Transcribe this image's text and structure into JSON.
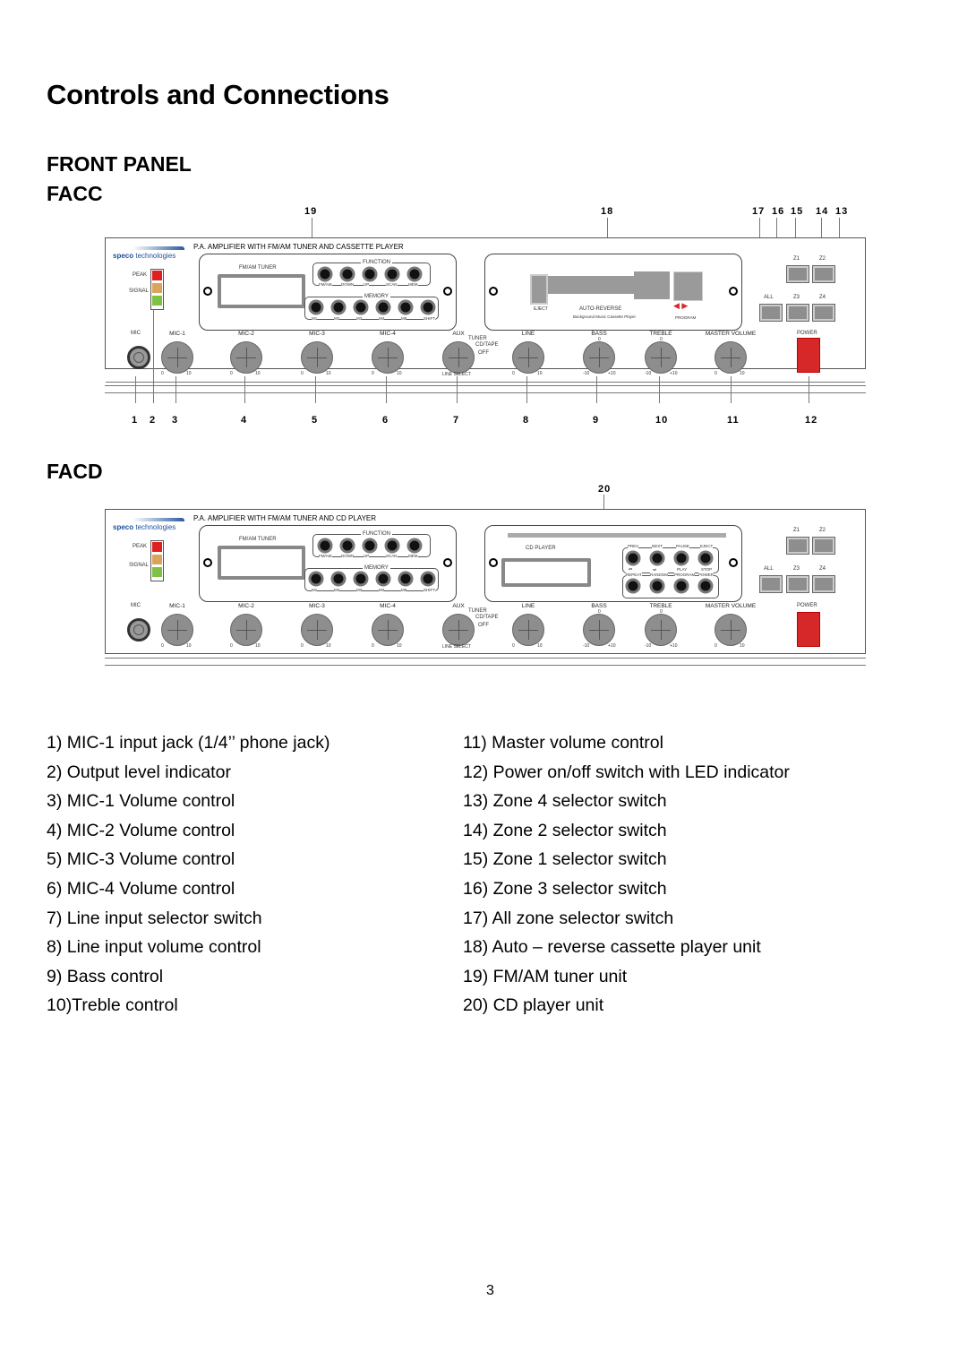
{
  "page": {
    "title": "Controls and Connections",
    "section": "FRONT PANEL",
    "page_number": "3"
  },
  "facc": {
    "heading": "FACC",
    "panel_title": "P.A. AMPLIFIER WITH FM/AM TUNER AND CASSETTE PLAYER",
    "logo": {
      "brand": "speco",
      "suffix": " technologies"
    },
    "indicators": {
      "peak": "PEAK",
      "signal": "SIGNAL",
      "colors": [
        "#e02020",
        "#d9a55a",
        "#7cc243"
      ]
    },
    "tuner": {
      "label": "FM/AM TUNER",
      "function_label": "FUNCTION",
      "function_buttons": [
        "FM/AM",
        "DOWN",
        "UP",
        "SCAN",
        "MEM"
      ],
      "memory_label": "MEMORY",
      "memory_buttons": [
        "M1",
        "M2",
        "M3",
        "M4",
        "M5",
        "SHIFT"
      ]
    },
    "cassette": {
      "eject": "EJECT",
      "auto_reverse": "AUTO-REVERSE",
      "subtitle": "Background Music Cassette Player",
      "program": "PROGRAM"
    },
    "zones": [
      "Z1",
      "Z2",
      "ALL",
      "Z3",
      "Z4"
    ],
    "controls": {
      "mic": "MIC",
      "mic1": "MIC-1",
      "mic2": "MIC-2",
      "mic3": "MIC-3",
      "mic4": "MIC-4",
      "aux": "AUX",
      "tuner": "TUNER",
      "cdtape": "CD/TAPE",
      "off": "OFF",
      "line_select": "LINE SELECT",
      "line": "LINE",
      "bass": "BASS",
      "treble": "TREBLE",
      "master": "MASTER VOLUME",
      "power": "POWER",
      "scale_min": "0",
      "scale_max": "10",
      "tone_min": "-10",
      "tone_max": "+10",
      "tone_mid": "0"
    },
    "callouts_top": [
      "19",
      "18",
      "17",
      "16",
      "15",
      "14",
      "13"
    ],
    "callouts_bottom": [
      "1",
      "2",
      "3",
      "4",
      "5",
      "6",
      "7",
      "8",
      "9",
      "10",
      "11",
      "12"
    ]
  },
  "facd": {
    "heading": "FACD",
    "panel_title": "P.A. AMPLIFIER WITH FM/AM TUNER AND CD PLAYER",
    "cd": {
      "label": "CD PLAYER",
      "top_buttons": [
        "PREV",
        "NEXT",
        "PAUSE",
        "EJECT"
      ],
      "mid_labels": [
        "⏮",
        "⏭",
        "PLAY",
        "STOP"
      ],
      "bottom_buttons": [
        "REPEAT",
        "RANDOM",
        "PROGRAM",
        "POWER"
      ]
    },
    "callout": "20"
  },
  "legend": {
    "left": [
      "1) MIC-1 input jack (1/4’’ phone jack)",
      "2) Output level indicator",
      "3) MIC-1 Volume control",
      "4) MIC-2 Volume control",
      "5) MIC-3 Volume control",
      "6) MIC-4 Volume control",
      "7) Line input selector switch",
      "8) Line input volume control",
      "9) Bass control",
      "10)Treble control"
    ],
    "right": [
      "11) Master volume control",
      "12) Power on/off switch with LED indicator",
      "13) Zone 4 selector switch",
      "14) Zone 2 selector switch",
      "15) Zone 1 selector switch",
      "16) Zone 3 selector switch",
      "17) All zone selector switch",
      "18) Auto – reverse cassette player unit",
      "19) FM/AM tuner unit",
      "20) CD player unit"
    ]
  }
}
